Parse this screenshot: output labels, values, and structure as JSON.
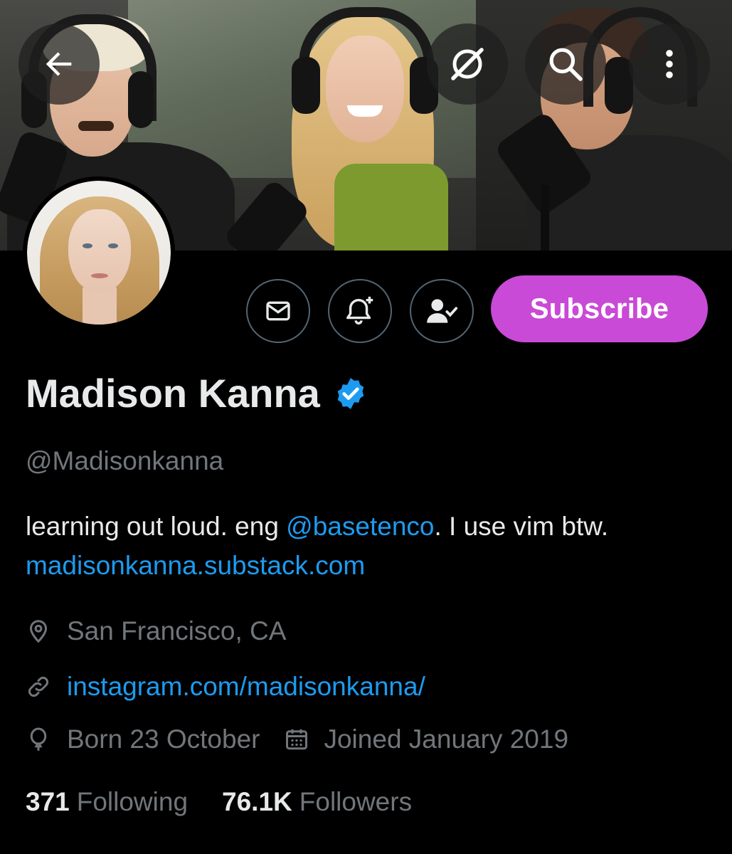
{
  "header": {
    "back_icon": "arrow-left-icon",
    "mute_icon": "slashed-circle-icon",
    "search_icon": "search-icon",
    "more_icon": "vertical-dots-icon"
  },
  "actions": {
    "message_icon": "envelope-icon",
    "notify_icon": "bell-plus-icon",
    "following_icon": "person-check-icon",
    "subscribe_label": "Subscribe"
  },
  "profile": {
    "name": "Madison Kanna",
    "verified_icon": "verified-badge-icon",
    "handle": "@Madisonkanna",
    "bio_part1": "learning out loud. eng ",
    "bio_mention": "@basetenco",
    "bio_part2": ". I use vim btw. ",
    "bio_url": "madisonkanna.substack.com",
    "location": "San Francisco, CA",
    "website": "instagram.com/madisonkanna/",
    "birthday": "Born 23 October",
    "joined": "Joined January 2019"
  },
  "stats": {
    "following_count": "371",
    "following_label": "Following",
    "followers_count": "76.1K",
    "followers_label": "Followers"
  },
  "colors": {
    "background": "#000000",
    "link": "#1d9bf0",
    "secondary_text": "#71767b",
    "subscribe": "#c94ad6",
    "verified": "#1d9bf0"
  }
}
